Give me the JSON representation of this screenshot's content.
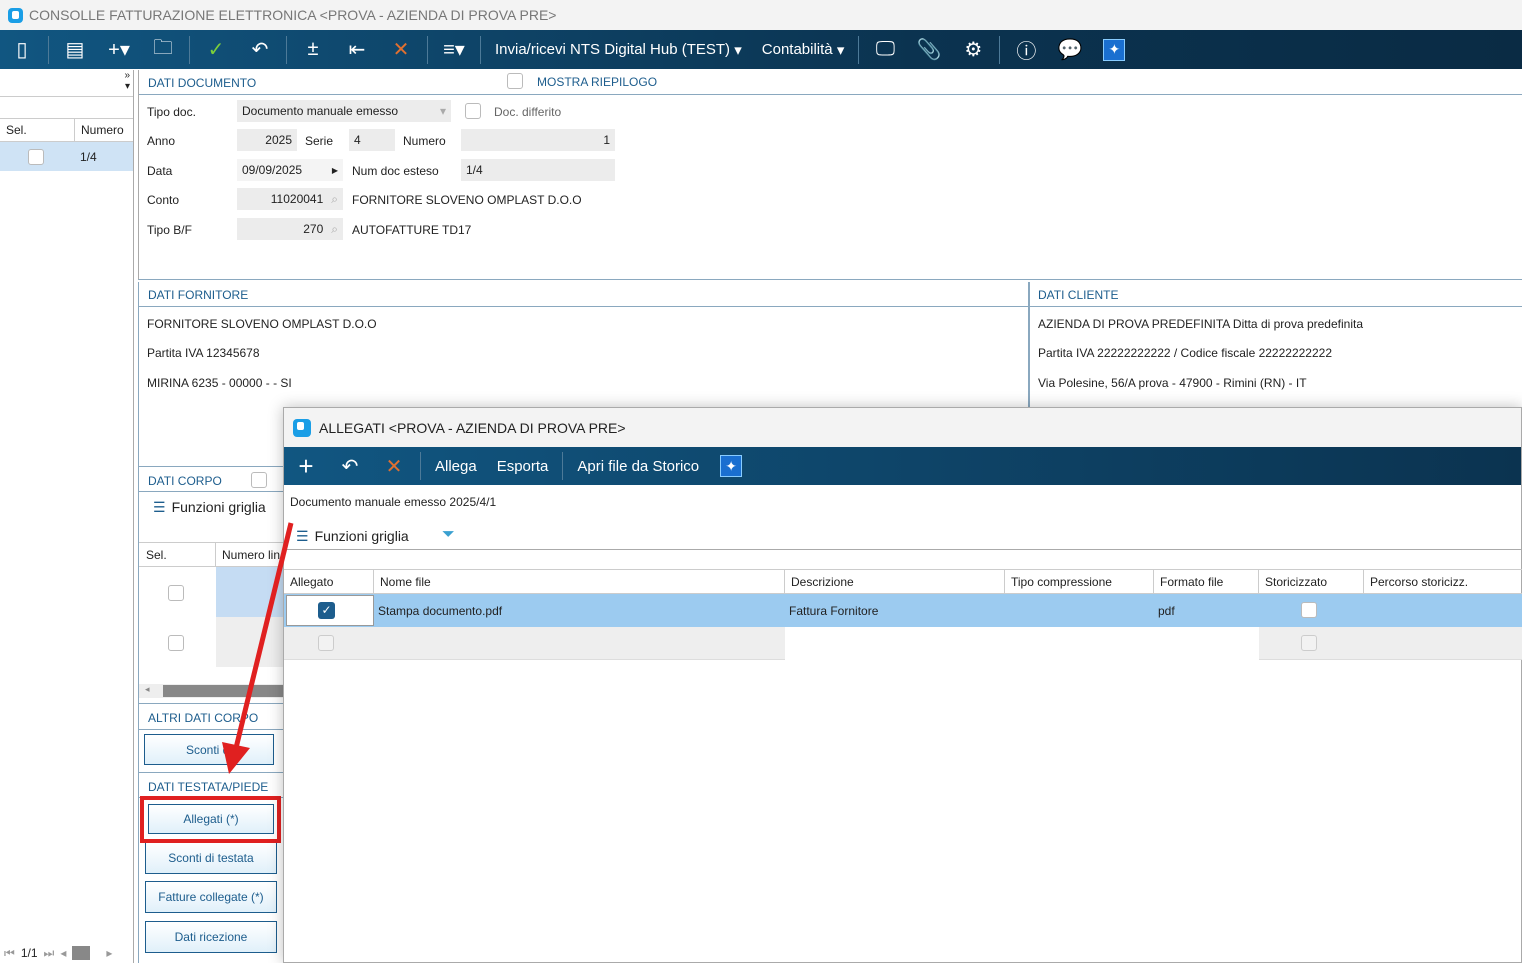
{
  "window": {
    "title": "CONSOLLE FATTURAZIONE ELETTRONICA <PROVA - AZIENDA DI PROVA PRE>"
  },
  "toolbar": {
    "hub": "Invia/ricevi NTS Digital Hub (TEST)",
    "contabilita": "Contabilità"
  },
  "left": {
    "col_sel": "Sel.",
    "col_num": "Numero",
    "row_num": "1/4",
    "pager": "1/1"
  },
  "doc": {
    "section": "DATI DOCUMENTO",
    "mostra": "MOSTRA RIEPILOGO",
    "tipo_doc_label": "Tipo doc.",
    "tipo_doc": "Documento manuale emesso",
    "differito": "Doc. differito",
    "anno_label": "Anno",
    "anno": "2025",
    "serie_label": "Serie",
    "serie": "4",
    "numero_label": "Numero",
    "numero": "1",
    "data_label": "Data",
    "data": "09/09/2025",
    "num_esteso_label": "Num doc esteso",
    "num_esteso": "1/4",
    "conto_label": "Conto",
    "conto": "11020041",
    "conto_desc": "FORNITORE SLOVENO OMPLAST D.O.O",
    "tipobf_label": "Tipo B/F",
    "tipobf": "270",
    "tipobf_desc": "AUTOFATTURE TD17"
  },
  "fornitore": {
    "section": "DATI FORNITORE",
    "name": "FORNITORE SLOVENO OMPLAST D.O.O",
    "piva": "Partita IVA 12345678",
    "addr": "MIRINA 6235 - 00000 -  - SI"
  },
  "cliente": {
    "section": "DATI CLIENTE",
    "name": "AZIENDA DI PROVA PREDEFINITA Ditta di prova predefinita",
    "piva": "Partita IVA 22222222222 / Codice fiscale 22222222222",
    "addr": "Via Polesine, 56/A prova - 47900 - Rimini (RN)  - IT"
  },
  "corpo": {
    "section": "DATI CORPO",
    "funzioni": "Funzioni griglia",
    "col_sel": "Sel.",
    "col_num": "Numero lin",
    "altri": "ALTRI DATI CORPO",
    "sconti": "Sconti di"
  },
  "testata": {
    "section": "DATI TESTATA/PIEDE",
    "allegati": "Allegati (*)",
    "sconti": "Sconti di testata",
    "fatture": "Fatture collegate (*)",
    "ricezione": "Dati ricezione"
  },
  "dialog": {
    "title": "ALLEGATI <PROVA - AZIENDA DI PROVA PRE>",
    "allega": "Allega",
    "esporta": "Esporta",
    "apri": "Apri file da Storico",
    "doc": "Documento manuale emesso 2025/4/1",
    "funzioni": "Funzioni griglia",
    "columns": [
      "Allegato",
      "Nome file",
      "Descrizione",
      "Tipo compressione",
      "Formato file",
      "Storicizzato",
      "Percorso storicizz."
    ],
    "rows": [
      {
        "nome": "Stampa documento.pdf",
        "descrizione": "Fattura Fornitore",
        "tipo": "",
        "formato": "pdf",
        "percorso": ""
      }
    ]
  },
  "colors": {
    "toolbar": "#0b3350",
    "accent": "#1d5d8d",
    "highlight": "#9ccbf0",
    "annotation": "#e02020"
  }
}
